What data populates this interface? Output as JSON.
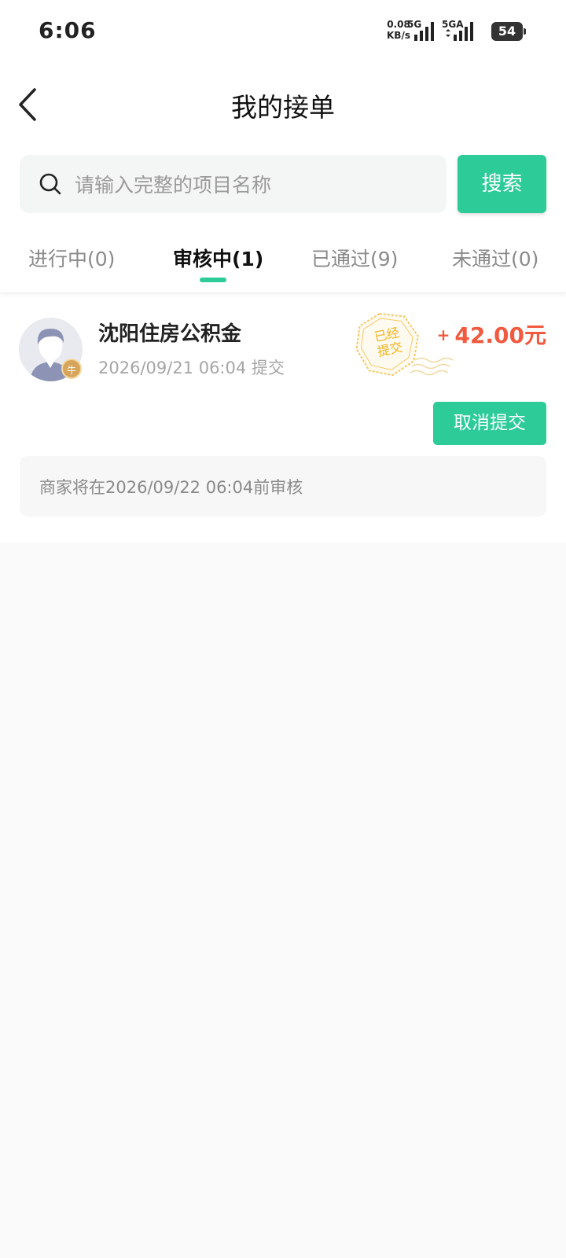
{
  "status_bar": {
    "time": "6:06",
    "net_speed_value": "0.08",
    "net_speed_unit": "KB/s",
    "signal1_label": "5G",
    "signal2_label": "5GA",
    "battery": "54"
  },
  "header": {
    "title": "我的接单"
  },
  "search": {
    "placeholder": "请输入完整的项目名称",
    "button_label": "搜索"
  },
  "tabs": [
    {
      "label": "进行中(0)",
      "active": false
    },
    {
      "label": "审核中(1)",
      "active": true
    },
    {
      "label": "已通过(9)",
      "active": false
    },
    {
      "label": "未通过(0)",
      "active": false
    }
  ],
  "task": {
    "title": "沈阳住房公积金",
    "submitted_time": "2026/09/21 06:04 提交",
    "stamp_line1": "已经",
    "stamp_line2": "提交",
    "price_sign": "+",
    "price": "42.00元",
    "avatar_badge": "牛",
    "cancel_label": "取消提交",
    "notice": "商家将在2026/09/22 06:04前审核"
  },
  "colors": {
    "accent": "#2dcb97",
    "price": "#f15a3f",
    "stamp": "#f2b21a"
  }
}
